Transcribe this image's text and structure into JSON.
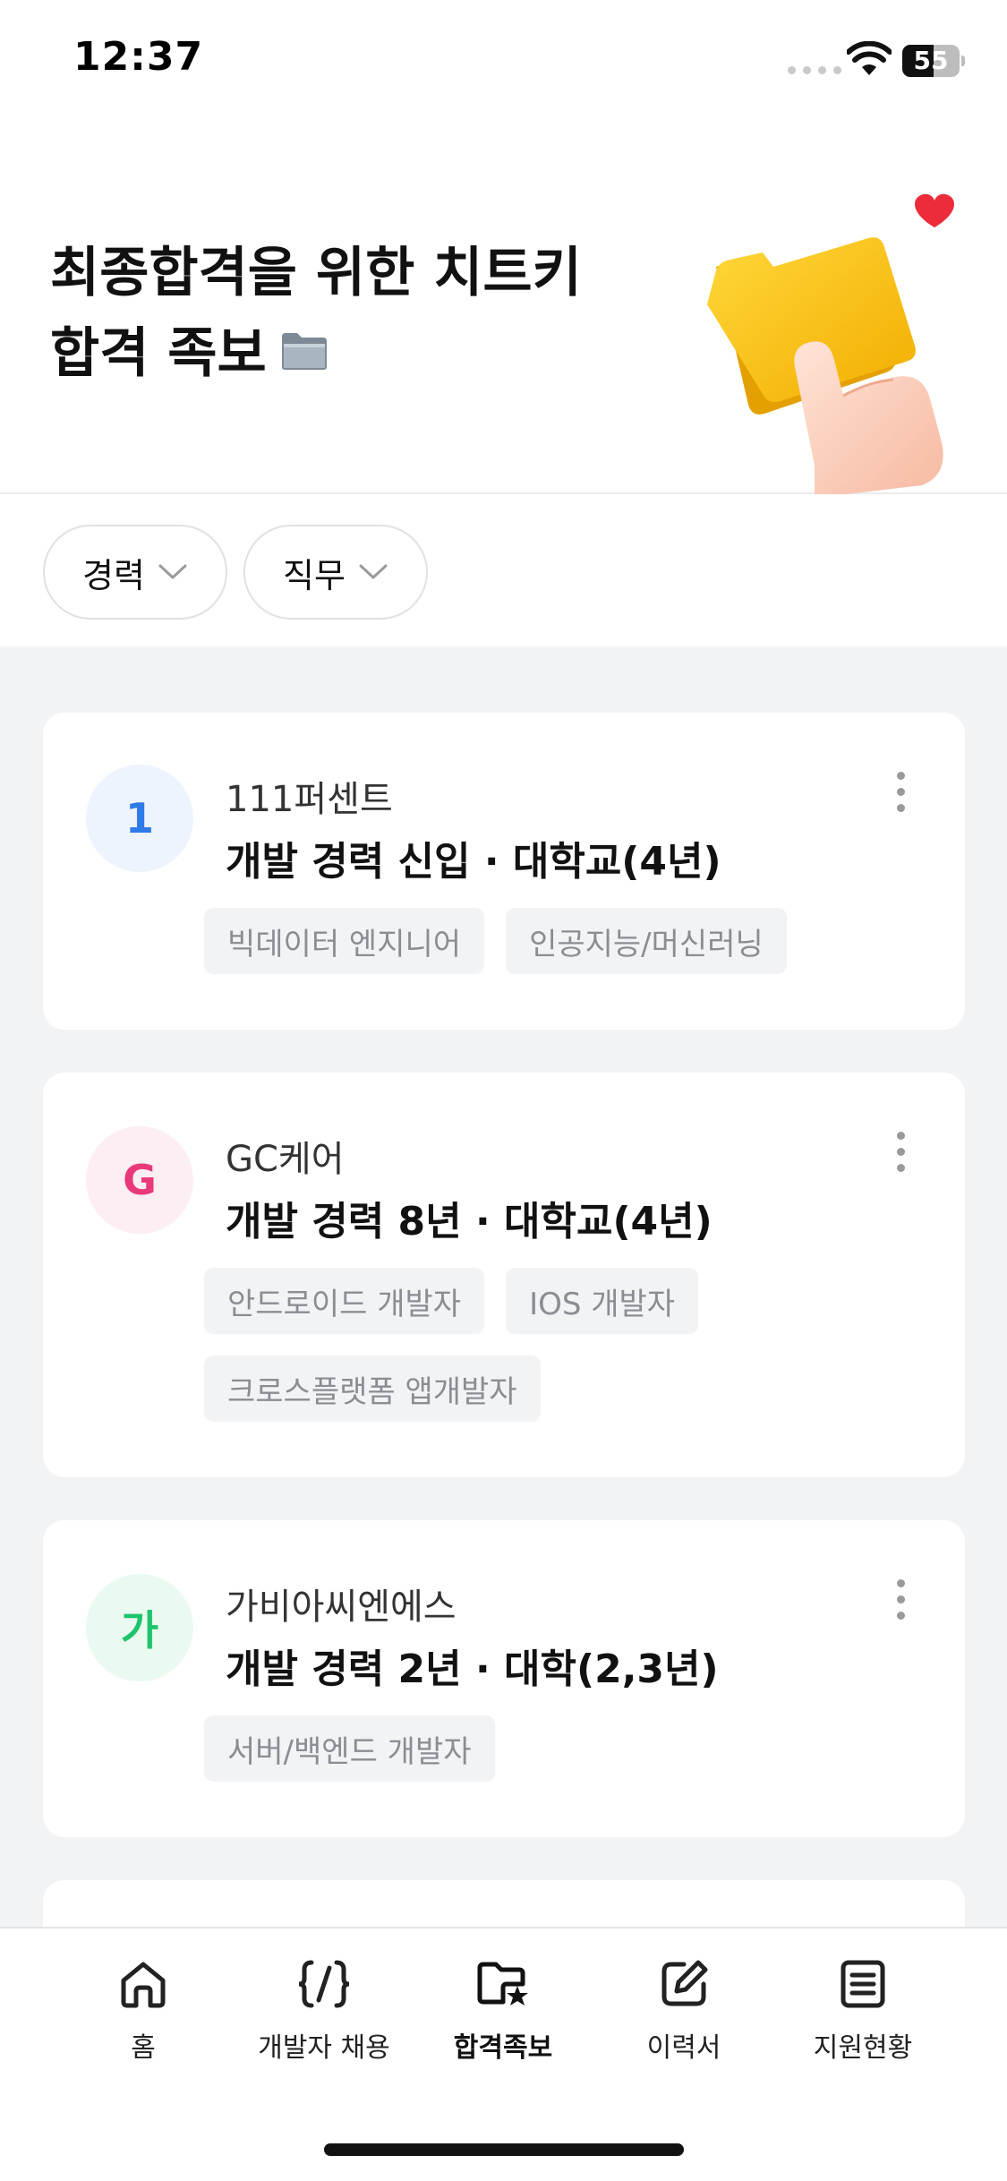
{
  "status_bar": {
    "time": "12:37",
    "battery": "55",
    "battery_level": 0.55
  },
  "hero": {
    "title_line1": "최종합격을 위한 치트키",
    "title_line2": "합격 족보"
  },
  "filters": [
    {
      "label": "경력"
    },
    {
      "label": "직무"
    }
  ],
  "cards": [
    {
      "avatar_letter": "1",
      "avatar_color": "#2f7be8",
      "avatar_bg": "#eef4fd",
      "company": "111퍼센트",
      "career": "개발 경력 신입 · 대학교(4년)",
      "tags": [
        "빅데이터 엔지니어",
        "인공지능/머신러닝"
      ]
    },
    {
      "avatar_letter": "G",
      "avatar_color": "#e8397a",
      "avatar_bg": "#fdeef3",
      "company": "GC케어",
      "career": "개발 경력 8년 · 대학교(4년)",
      "tags": [
        "안드로이드 개발자",
        "IOS 개발자",
        "크로스플랫폼 앱개발자"
      ]
    },
    {
      "avatar_letter": "가",
      "avatar_color": "#1ec46b",
      "avatar_bg": "#eafaf1",
      "company": "가비아씨엔에스",
      "career": "개발 경력 2년 · 대학(2,3년)",
      "tags": [
        "서버/백엔드 개발자"
      ]
    }
  ],
  "bottom_nav": [
    {
      "label": "홈",
      "icon": "home-icon"
    },
    {
      "label": "개발자 채용",
      "icon": "code-icon"
    },
    {
      "label": "합격족보",
      "icon": "folder-star-icon",
      "active": true
    },
    {
      "label": "이력서",
      "icon": "edit-icon"
    },
    {
      "label": "지원현황",
      "icon": "document-list-icon"
    }
  ]
}
